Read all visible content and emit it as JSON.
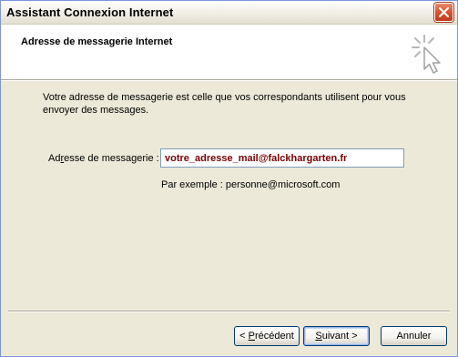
{
  "window": {
    "title": "Assistant Connexion Internet",
    "close_icon": "close-icon"
  },
  "header": {
    "title": "Adresse de messagerie Internet",
    "icon": "wizard-sparkle-cursor-icon"
  },
  "content": {
    "description": "Votre adresse de messagerie est celle que vos correspondants utilisent pour vous envoyer des messages.",
    "email_label_prefix": "Ad",
    "email_label_mnemonic": "r",
    "email_label_suffix": "esse de messagerie :",
    "email_value": "votre_adresse_mail@falckhargarten.fr",
    "example": "Par exemple : personne@microsoft.com"
  },
  "buttons": {
    "prev_prefix": "< ",
    "prev_mnemonic": "P",
    "prev_suffix": "récédent",
    "next_mnemonic": "S",
    "next_suffix": "uivant >",
    "cancel": "Annuler"
  },
  "colors": {
    "dialog_bg": "#ece9d8",
    "input_text": "#7a0000",
    "close_button": "#d9532d"
  }
}
